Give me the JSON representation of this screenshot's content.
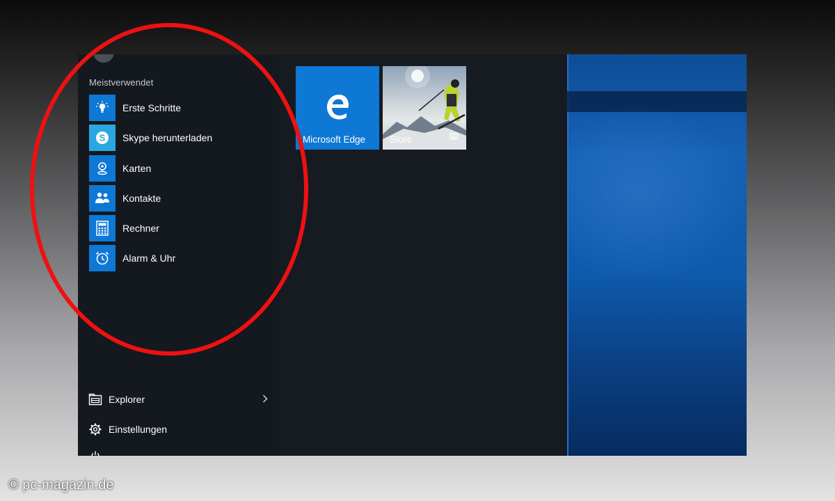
{
  "start_menu": {
    "section_title": "Meistverwendet",
    "most_used": [
      {
        "label": "Erste Schritte",
        "icon": "lightbulb-icon"
      },
      {
        "label": "Skype herunterladen",
        "icon": "skype-icon"
      },
      {
        "label": "Karten",
        "icon": "maps-icon"
      },
      {
        "label": "Kontakte",
        "icon": "contacts-icon"
      },
      {
        "label": "Rechner",
        "icon": "calculator-icon"
      },
      {
        "label": "Alarm & Uhr",
        "icon": "alarm-clock-icon"
      }
    ],
    "bottom": {
      "explorer": {
        "label": "Explorer",
        "icon": "file-explorer-icon"
      },
      "settings": {
        "label": "Einstellungen",
        "icon": "gear-icon"
      }
    },
    "tiles": [
      {
        "label": "Microsoft Edge",
        "icon": "edge-icon"
      },
      {
        "label": "Store",
        "icon": "store-icon"
      }
    ]
  },
  "colors": {
    "accent": "#0e78d5",
    "menu_background": "#161b21",
    "annotation": "#ee1111"
  },
  "watermark": "© pc-magazin.de"
}
